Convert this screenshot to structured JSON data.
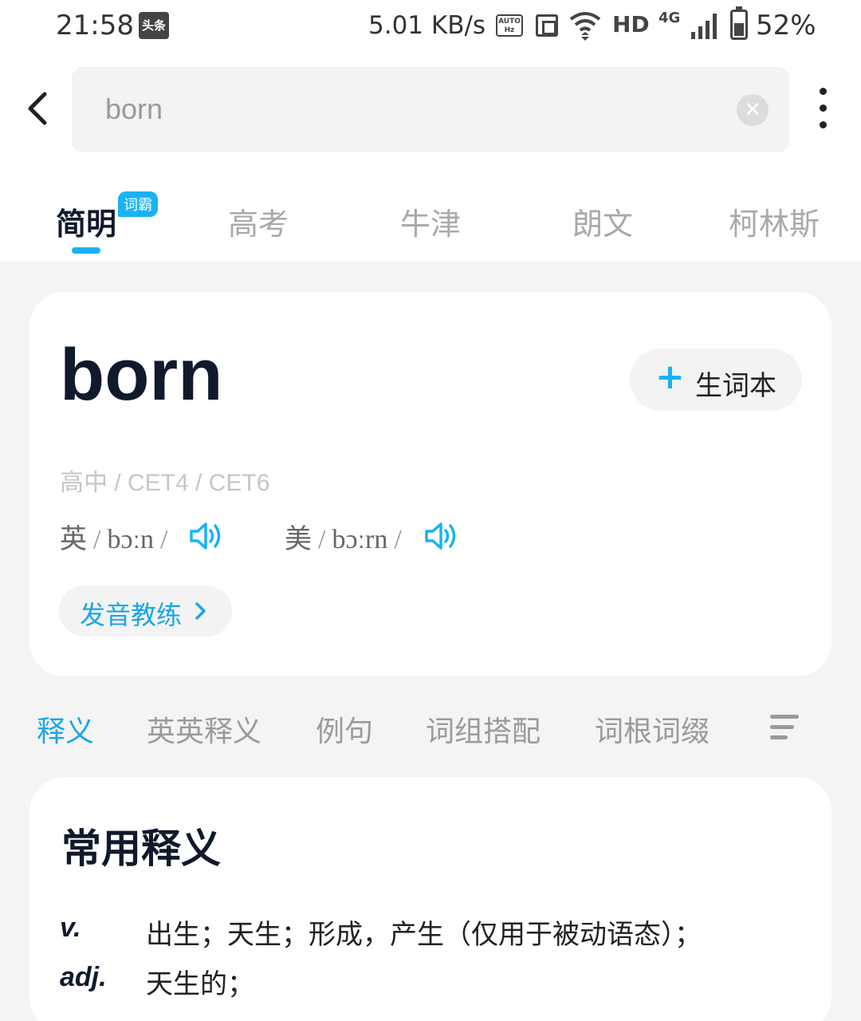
{
  "status_bar": {
    "time": "21:58",
    "app_badge": "头条",
    "net_speed": "5.01 KB/s",
    "auto_hz": "AUTO Hz",
    "hd": "HD",
    "network": "4G",
    "battery": "52%"
  },
  "search": {
    "query": "born"
  },
  "dict_tabs": [
    {
      "label": "简明",
      "badge": "词霸",
      "active": true
    },
    {
      "label": "高考"
    },
    {
      "label": "牛津"
    },
    {
      "label": "朗文"
    },
    {
      "label": "柯林斯"
    }
  ],
  "word": {
    "headword": "born",
    "add_vocab_label": "生词本",
    "levels": "高中 / CET4 / CET6",
    "uk_label": "英",
    "uk_ipa": "bɔːn",
    "us_label": "美",
    "us_ipa": "bɔːrn",
    "coach_label": "发音教练"
  },
  "section_tabs": [
    {
      "label": "释义",
      "active": true
    },
    {
      "label": "英英释义"
    },
    {
      "label": "例句"
    },
    {
      "label": "词组搭配"
    },
    {
      "label": "词根词缀"
    }
  ],
  "definitions": {
    "title": "常用释义",
    "items": [
      {
        "pos": "v.",
        "meaning": "出生；天生；形成，产生（仅用于被动语态）；"
      },
      {
        "pos": "adj.",
        "meaning": "天生的；"
      }
    ]
  },
  "colors": {
    "accent": "#19b2f5",
    "text_dark": "#111a2c",
    "background": "#f4f4f4"
  }
}
